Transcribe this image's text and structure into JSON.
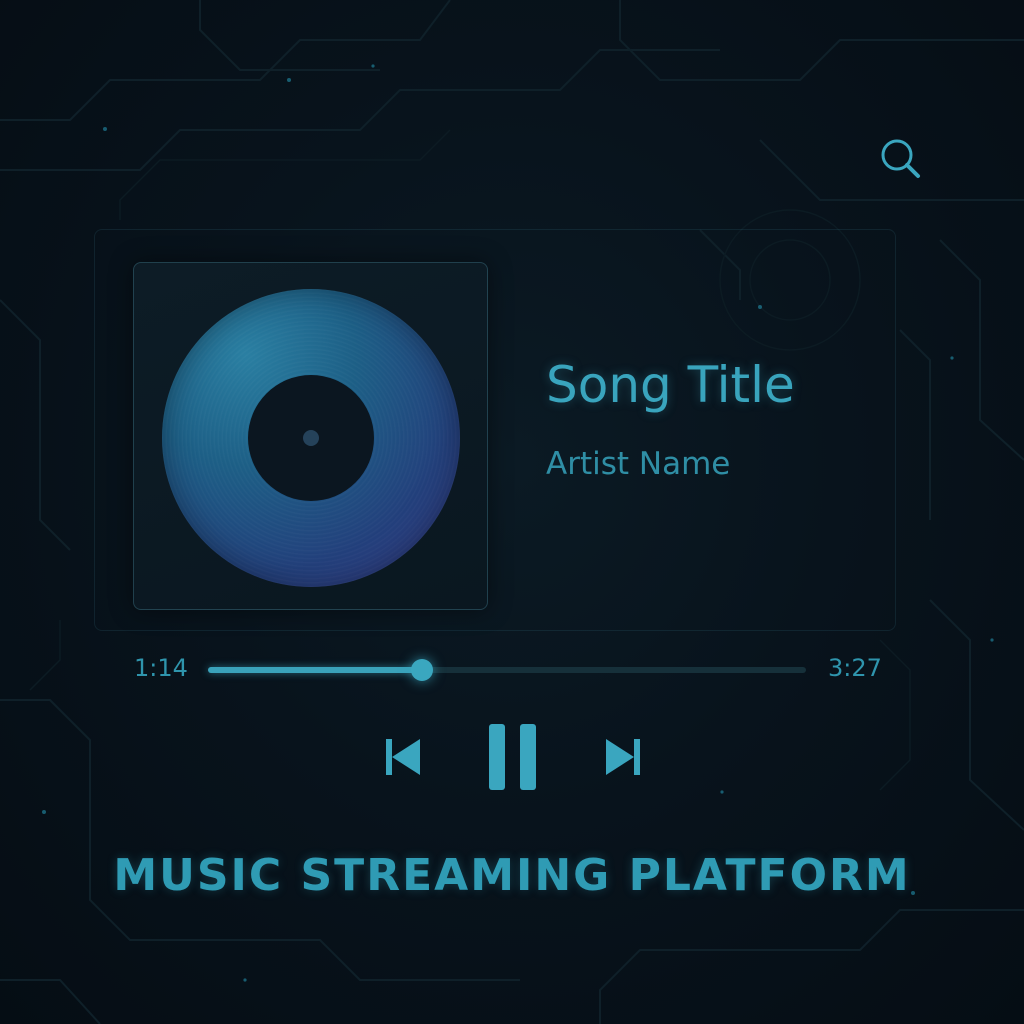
{
  "colors": {
    "accent": "#39a4bd",
    "background": "#07111a",
    "track": "#16303a"
  },
  "header": {
    "search_icon": "search-icon"
  },
  "now_playing": {
    "album_art_icon": "vinyl-record-icon",
    "song_title": "Song Title",
    "artist_name": "Artist Name"
  },
  "playback": {
    "current_time": "1:14",
    "total_time": "3:27",
    "progress_fraction": 0.3575
  },
  "controls": {
    "previous_icon": "skip-previous-icon",
    "pause_icon": "pause-icon",
    "next_icon": "skip-next-icon"
  },
  "footer": {
    "platform_title": "MUSIC STREAMING PLATFORM"
  }
}
